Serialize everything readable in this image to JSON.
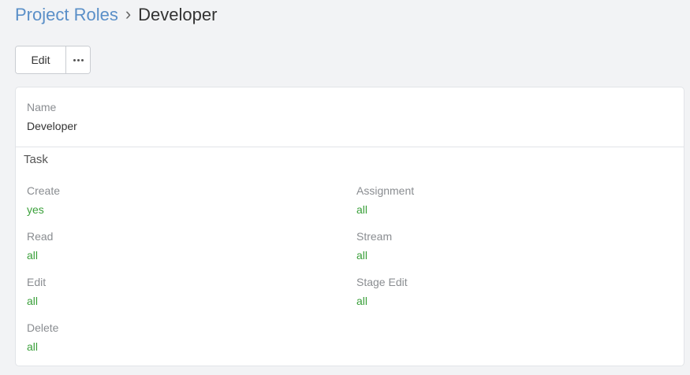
{
  "breadcrumb": {
    "parent": "Project Roles",
    "separator": "›",
    "current": "Developer"
  },
  "toolbar": {
    "edit_label": "Edit",
    "more_icon": "more-horizontal-icon"
  },
  "record": {
    "name_label": "Name",
    "name_value": "Developer"
  },
  "task_section": {
    "title": "Task",
    "left_fields": [
      {
        "label": "Create",
        "value": "yes"
      },
      {
        "label": "Read",
        "value": "all"
      },
      {
        "label": "Edit",
        "value": "all"
      },
      {
        "label": "Delete",
        "value": "all"
      }
    ],
    "right_fields": [
      {
        "label": "Assignment",
        "value": "all"
      },
      {
        "label": "Stream",
        "value": "all"
      },
      {
        "label": "Stage Edit",
        "value": "all"
      }
    ]
  },
  "colors": {
    "link": "#5a8fc8",
    "value_green": "#3aa03a",
    "label_gray": "#8a8d91",
    "background": "#f2f3f5"
  }
}
